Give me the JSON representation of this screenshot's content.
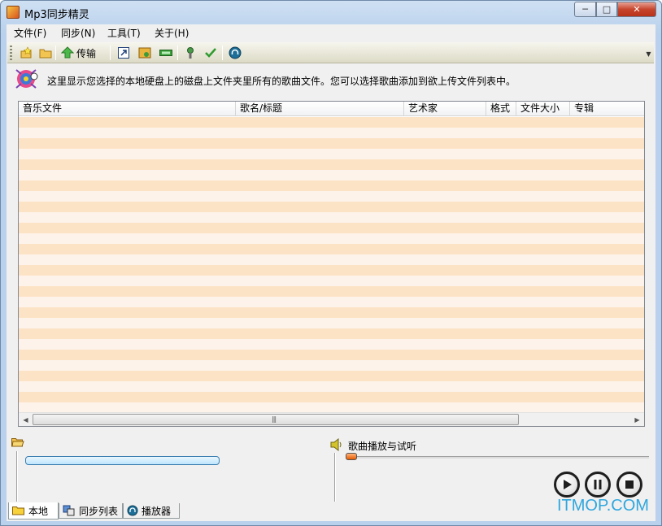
{
  "window": {
    "title": "Mp3同步精灵"
  },
  "menu": [
    {
      "label": "文件(F)"
    },
    {
      "label": "同步(N)"
    },
    {
      "label": "工具(T)"
    },
    {
      "label": "关于(H)"
    }
  ],
  "toolbar": {
    "transfer_label": "传输"
  },
  "info": {
    "text": "这里显示您选择的本地硬盘上的磁盘上文件夹里所有的歌曲文件。您可以选择歌曲添加到欲上传文件列表中。"
  },
  "list": {
    "columns": [
      "音乐文件",
      "歌名/标题",
      "艺术家",
      "格式",
      "文件大小",
      "专辑"
    ],
    "rows": []
  },
  "player": {
    "label": "歌曲播放与试听"
  },
  "tabs": [
    {
      "label": "本地"
    },
    {
      "label": "同步列表"
    },
    {
      "label": "播放器"
    }
  ],
  "watermark": "ITMOP.COM",
  "colors": {
    "row_odd": "#fde3c6",
    "row_even": "#fdf3ea",
    "accent": "#2fa7de"
  }
}
